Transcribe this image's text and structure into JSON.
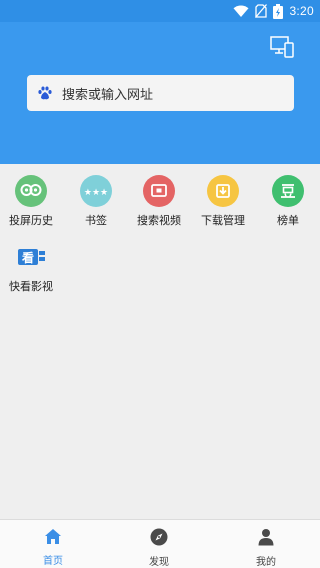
{
  "status": {
    "time": "3:20",
    "icons": [
      "wifi-icon",
      "no-sim-icon",
      "battery-icon"
    ]
  },
  "header": {
    "cast_icon": "multi-screen-icon"
  },
  "search": {
    "placeholder": "搜索或输入网址",
    "logo": "paw-logo-icon"
  },
  "shortcuts": [
    {
      "label": "投屏历史",
      "icon": "glasses-icon",
      "color": "#66c27a"
    },
    {
      "label": "书签",
      "icon": "stars-icon",
      "color": "#7fd0d9"
    },
    {
      "label": "搜索视频",
      "icon": "tv-icon",
      "color": "#e46464"
    },
    {
      "label": "下载管理",
      "icon": "download-icon",
      "color": "#f6c542"
    },
    {
      "label": "榜单",
      "icon": "douban-icon",
      "color": "#3fbf6f"
    },
    {
      "label": "快看影视",
      "icon": "kuaikan-icon",
      "color": "#2e7fd6"
    }
  ],
  "tabs": [
    {
      "label": "首页",
      "icon": "home-icon",
      "active": true
    },
    {
      "label": "发现",
      "icon": "compass-icon",
      "active": false
    },
    {
      "label": "我的",
      "icon": "person-icon",
      "active": false
    }
  ],
  "colors": {
    "header_bg": "#3a99ee",
    "statusbar_bg": "#2f8fe6",
    "accent": "#3a8ee6"
  }
}
